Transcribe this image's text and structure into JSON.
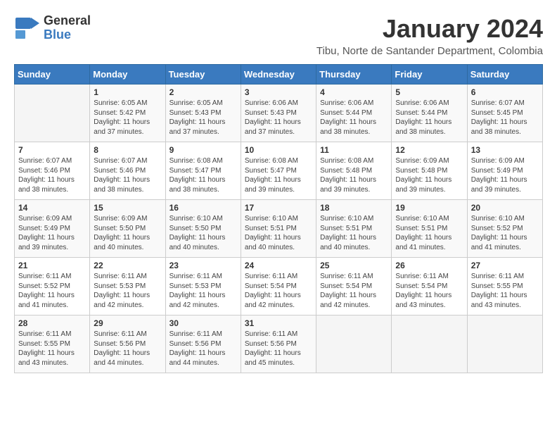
{
  "header": {
    "logo_line1": "General",
    "logo_line2": "Blue",
    "month": "January 2024",
    "location": "Tibu, Norte de Santander Department, Colombia"
  },
  "weekdays": [
    "Sunday",
    "Monday",
    "Tuesday",
    "Wednesday",
    "Thursday",
    "Friday",
    "Saturday"
  ],
  "weeks": [
    [
      {
        "day": "",
        "text": ""
      },
      {
        "day": "1",
        "text": "Sunrise: 6:05 AM\nSunset: 5:42 PM\nDaylight: 11 hours\nand 37 minutes."
      },
      {
        "day": "2",
        "text": "Sunrise: 6:05 AM\nSunset: 5:43 PM\nDaylight: 11 hours\nand 37 minutes."
      },
      {
        "day": "3",
        "text": "Sunrise: 6:06 AM\nSunset: 5:43 PM\nDaylight: 11 hours\nand 37 minutes."
      },
      {
        "day": "4",
        "text": "Sunrise: 6:06 AM\nSunset: 5:44 PM\nDaylight: 11 hours\nand 38 minutes."
      },
      {
        "day": "5",
        "text": "Sunrise: 6:06 AM\nSunset: 5:44 PM\nDaylight: 11 hours\nand 38 minutes."
      },
      {
        "day": "6",
        "text": "Sunrise: 6:07 AM\nSunset: 5:45 PM\nDaylight: 11 hours\nand 38 minutes."
      }
    ],
    [
      {
        "day": "7",
        "text": "Sunrise: 6:07 AM\nSunset: 5:46 PM\nDaylight: 11 hours\nand 38 minutes."
      },
      {
        "day": "8",
        "text": "Sunrise: 6:07 AM\nSunset: 5:46 PM\nDaylight: 11 hours\nand 38 minutes."
      },
      {
        "day": "9",
        "text": "Sunrise: 6:08 AM\nSunset: 5:47 PM\nDaylight: 11 hours\nand 38 minutes."
      },
      {
        "day": "10",
        "text": "Sunrise: 6:08 AM\nSunset: 5:47 PM\nDaylight: 11 hours\nand 39 minutes."
      },
      {
        "day": "11",
        "text": "Sunrise: 6:08 AM\nSunset: 5:48 PM\nDaylight: 11 hours\nand 39 minutes."
      },
      {
        "day": "12",
        "text": "Sunrise: 6:09 AM\nSunset: 5:48 PM\nDaylight: 11 hours\nand 39 minutes."
      },
      {
        "day": "13",
        "text": "Sunrise: 6:09 AM\nSunset: 5:49 PM\nDaylight: 11 hours\nand 39 minutes."
      }
    ],
    [
      {
        "day": "14",
        "text": "Sunrise: 6:09 AM\nSunset: 5:49 PM\nDaylight: 11 hours\nand 39 minutes."
      },
      {
        "day": "15",
        "text": "Sunrise: 6:09 AM\nSunset: 5:50 PM\nDaylight: 11 hours\nand 40 minutes."
      },
      {
        "day": "16",
        "text": "Sunrise: 6:10 AM\nSunset: 5:50 PM\nDaylight: 11 hours\nand 40 minutes."
      },
      {
        "day": "17",
        "text": "Sunrise: 6:10 AM\nSunset: 5:51 PM\nDaylight: 11 hours\nand 40 minutes."
      },
      {
        "day": "18",
        "text": "Sunrise: 6:10 AM\nSunset: 5:51 PM\nDaylight: 11 hours\nand 40 minutes."
      },
      {
        "day": "19",
        "text": "Sunrise: 6:10 AM\nSunset: 5:51 PM\nDaylight: 11 hours\nand 41 minutes."
      },
      {
        "day": "20",
        "text": "Sunrise: 6:10 AM\nSunset: 5:52 PM\nDaylight: 11 hours\nand 41 minutes."
      }
    ],
    [
      {
        "day": "21",
        "text": "Sunrise: 6:11 AM\nSunset: 5:52 PM\nDaylight: 11 hours\nand 41 minutes."
      },
      {
        "day": "22",
        "text": "Sunrise: 6:11 AM\nSunset: 5:53 PM\nDaylight: 11 hours\nand 42 minutes."
      },
      {
        "day": "23",
        "text": "Sunrise: 6:11 AM\nSunset: 5:53 PM\nDaylight: 11 hours\nand 42 minutes."
      },
      {
        "day": "24",
        "text": "Sunrise: 6:11 AM\nSunset: 5:54 PM\nDaylight: 11 hours\nand 42 minutes."
      },
      {
        "day": "25",
        "text": "Sunrise: 6:11 AM\nSunset: 5:54 PM\nDaylight: 11 hours\nand 42 minutes."
      },
      {
        "day": "26",
        "text": "Sunrise: 6:11 AM\nSunset: 5:54 PM\nDaylight: 11 hours\nand 43 minutes."
      },
      {
        "day": "27",
        "text": "Sunrise: 6:11 AM\nSunset: 5:55 PM\nDaylight: 11 hours\nand 43 minutes."
      }
    ],
    [
      {
        "day": "28",
        "text": "Sunrise: 6:11 AM\nSunset: 5:55 PM\nDaylight: 11 hours\nand 43 minutes."
      },
      {
        "day": "29",
        "text": "Sunrise: 6:11 AM\nSunset: 5:56 PM\nDaylight: 11 hours\nand 44 minutes."
      },
      {
        "day": "30",
        "text": "Sunrise: 6:11 AM\nSunset: 5:56 PM\nDaylight: 11 hours\nand 44 minutes."
      },
      {
        "day": "31",
        "text": "Sunrise: 6:11 AM\nSunset: 5:56 PM\nDaylight: 11 hours\nand 45 minutes."
      },
      {
        "day": "",
        "text": ""
      },
      {
        "day": "",
        "text": ""
      },
      {
        "day": "",
        "text": ""
      }
    ]
  ]
}
